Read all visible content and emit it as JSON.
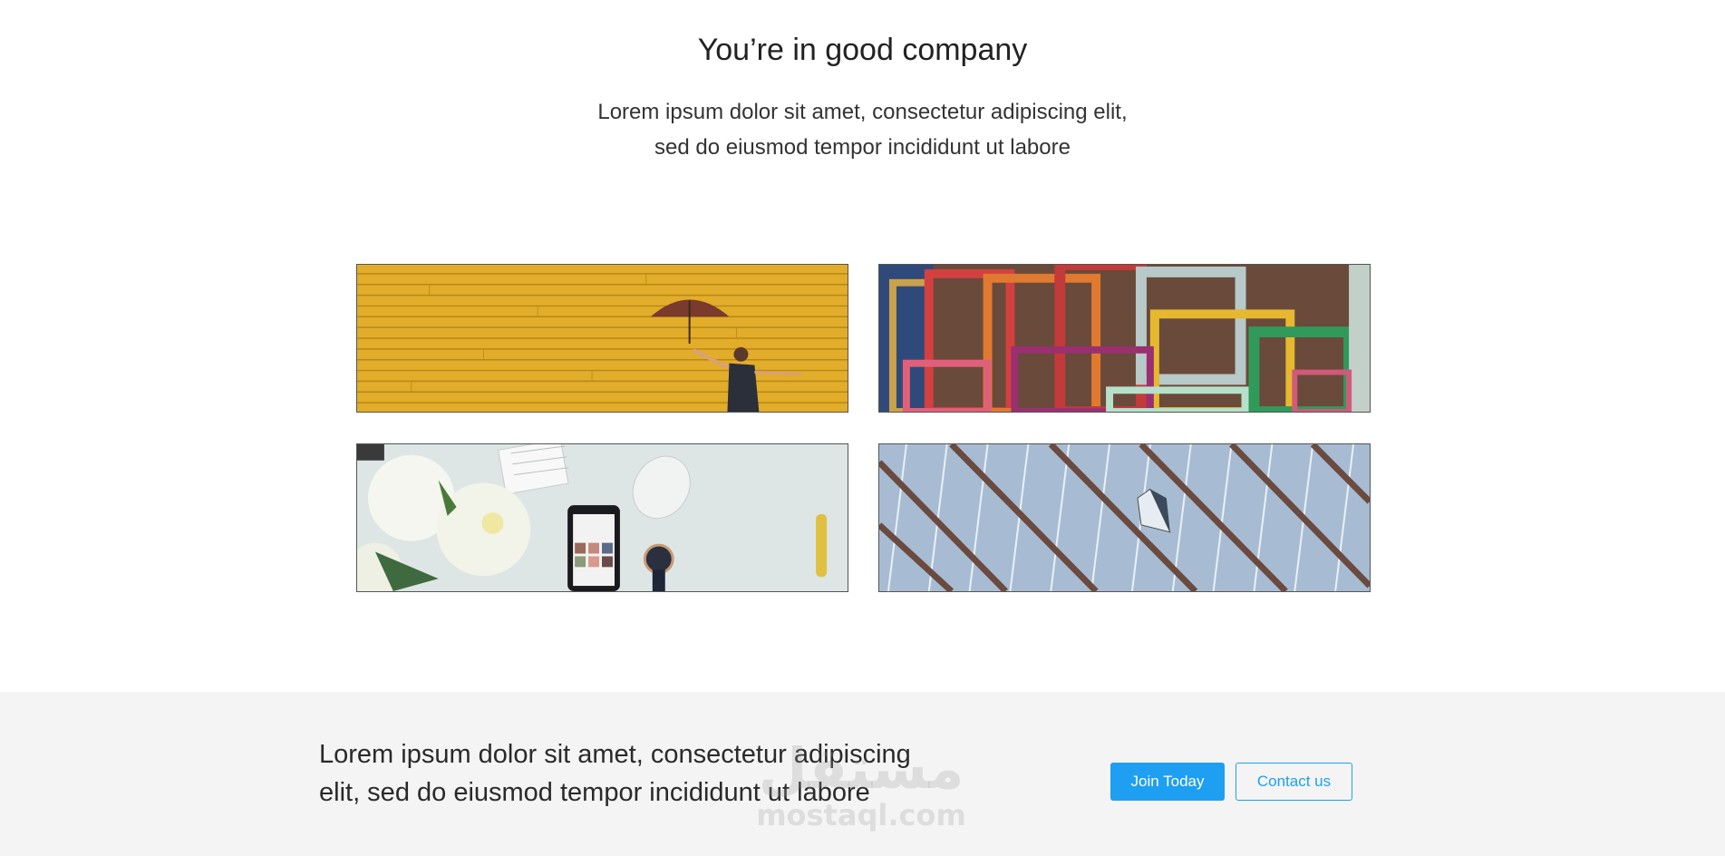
{
  "company": {
    "title": "You’re in good company",
    "subtitle_line1": "Lorem ipsum dolor sit amet, consectetur adipiscing elit,",
    "subtitle_line2": "sed do eiusmod tempor incididunt ut labore"
  },
  "gallery": {
    "images": [
      {
        "name": "umbrella-yellow-wall-photo"
      },
      {
        "name": "colorful-frames-photo"
      },
      {
        "name": "desk-flowers-phone-photo"
      },
      {
        "name": "glass-building-photo"
      }
    ]
  },
  "cta": {
    "text_line1": "Lorem ipsum dolor sit amet, consectetur adipiscing",
    "text_line2": "elit, sed do eiusmod tempor incididunt ut labore",
    "join_label": "Join Today",
    "contact_label": "Contact us",
    "accent_color": "#1e9ff2"
  },
  "watermark": {
    "logo_text": "مستقل",
    "url_text": "mostaql.com"
  }
}
